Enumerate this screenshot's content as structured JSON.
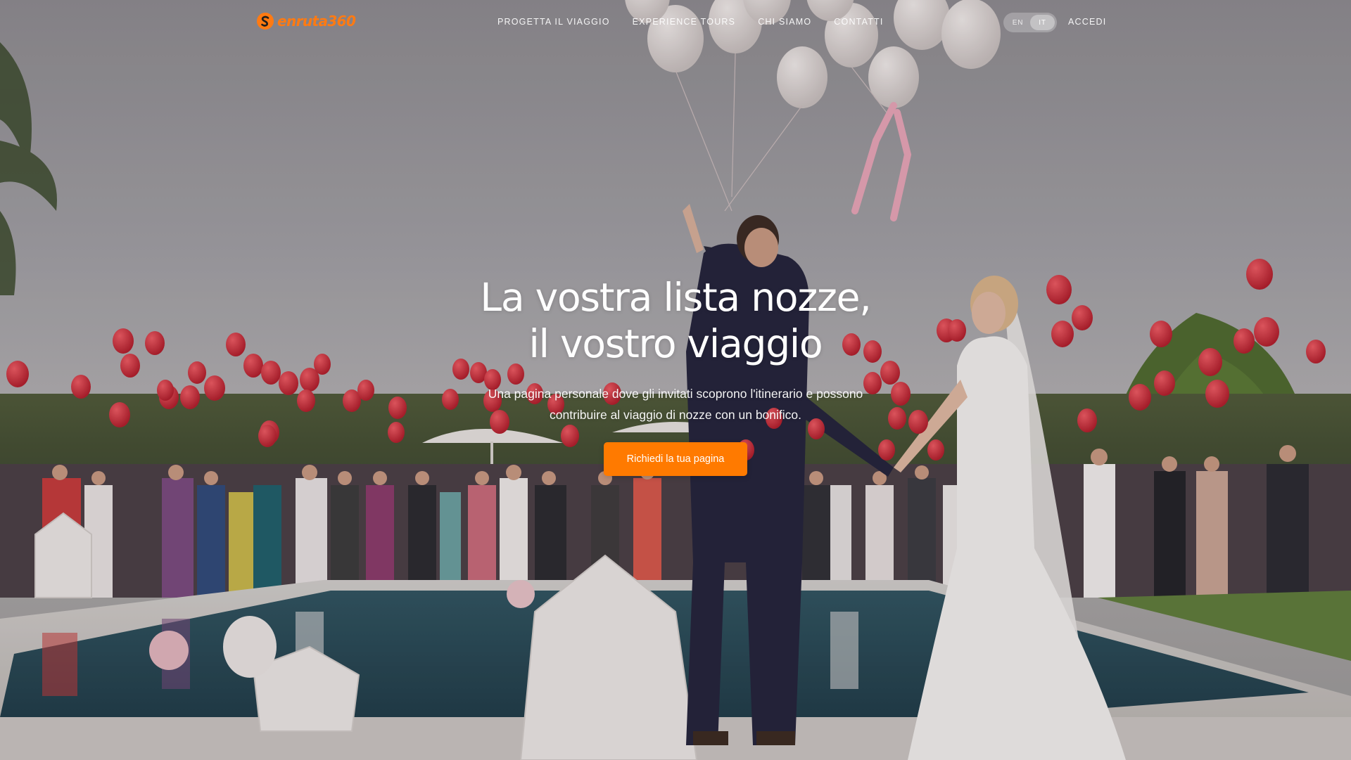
{
  "brand": {
    "logo_text": "enruta360",
    "accent_color": "#ff7a00"
  },
  "nav": {
    "items": [
      {
        "label": "PROGETTA IL VIAGGIO"
      },
      {
        "label": "EXPERIENCE TOURS"
      },
      {
        "label": "CHI SIAMO"
      },
      {
        "label": "CONTATTI"
      }
    ],
    "languages": [
      {
        "label": "EN",
        "active": false
      },
      {
        "label": "IT",
        "active": true
      }
    ],
    "login_label": "ACCEDI"
  },
  "hero": {
    "title_line1": "La vostra lista nozze,",
    "title_line2": "il vostro viaggio",
    "subtitle": "Una pagina personale dove gli invitati scoprono l'itinerario e possono contribuire al viaggio di nozze con un bonifico.",
    "cta_label": "Richiedi la tua pagina",
    "background_image": "wedding-balloons-photo"
  }
}
